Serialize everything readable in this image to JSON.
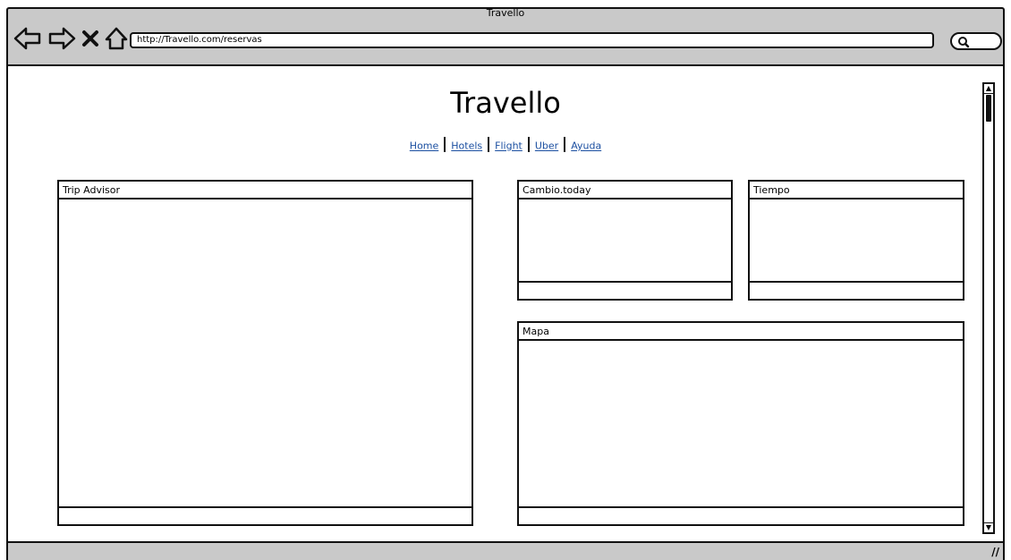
{
  "window": {
    "title": "Travello"
  },
  "url": "http://Travello.com/reservas",
  "page": {
    "title": "Travello"
  },
  "nav": [
    {
      "label": "Home"
    },
    {
      "label": "Hotels"
    },
    {
      "label": "Flight"
    },
    {
      "label": "Uber"
    },
    {
      "label": "Ayuda"
    }
  ],
  "panels": {
    "tripadvisor": "Trip Advisor",
    "cambio": "Cambio.today",
    "tiempo": "Tiempo",
    "mapa": "Mapa"
  },
  "icons": [
    "back-icon",
    "forward-icon",
    "close-icon",
    "home-icon",
    "search-icon",
    "resize-icon"
  ]
}
